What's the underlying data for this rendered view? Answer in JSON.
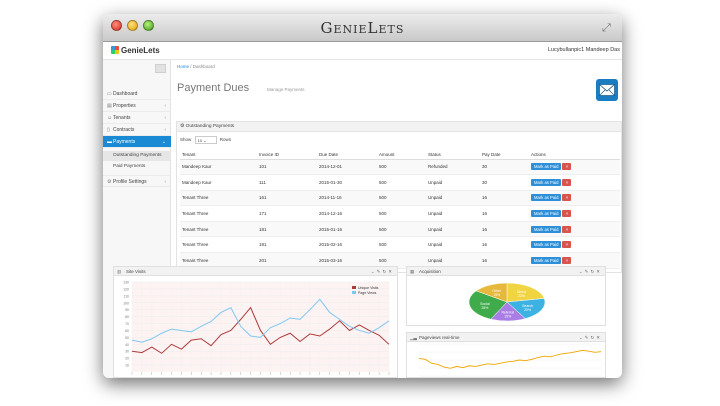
{
  "window": {
    "title": "GenieLets"
  },
  "topbar": {
    "brand": "GenieLets",
    "user": "Lucybullanpic1 Mandeep Das"
  },
  "sidebar": {
    "items": [
      {
        "label": "Dashboard",
        "icon": "monitor-icon"
      },
      {
        "label": "Properties",
        "icon": "building-icon"
      },
      {
        "label": "Tenants",
        "icon": "users-icon"
      },
      {
        "label": "Contracts",
        "icon": "document-icon"
      },
      {
        "label": "Payments",
        "icon": "card-icon"
      }
    ],
    "sub_items": [
      "Outstanding Payments",
      "Paid Payments"
    ],
    "profile": {
      "label": "Profile Settings",
      "icon": "gear-icon"
    }
  },
  "breadcrumb": {
    "home": "Home",
    "current": "Dashboard"
  },
  "page": {
    "title": "Payment Dues",
    "subtitle": "Manage Payments"
  },
  "panel": {
    "title": "Outstanding Payments",
    "show_label": "Show",
    "show_value": "10",
    "rows_label": "Rows"
  },
  "table": {
    "columns": [
      "Tenant",
      "Invoice ID",
      "Due Date",
      "Amount",
      "Status",
      "Pay Date",
      "Actions"
    ],
    "rows": [
      [
        "Mandeep Kaur",
        "101",
        "2014-12-01",
        "500",
        "Refunded",
        "30"
      ],
      [
        "Mandeep Kaur",
        "111",
        "2015-01-30",
        "500",
        "Unpaid",
        "30"
      ],
      [
        "Tenant Three",
        "161",
        "2014-11-16",
        "500",
        "Unpaid",
        "16"
      ],
      [
        "Tenant Three",
        "171",
        "2014-12-16",
        "500",
        "Unpaid",
        "16"
      ],
      [
        "Tenant Three",
        "181",
        "2015-01-16",
        "500",
        "Unpaid",
        "16"
      ],
      [
        "Tenant Three",
        "191",
        "2015-02-16",
        "500",
        "Unpaid",
        "16"
      ],
      [
        "Tenant Three",
        "201",
        "2015-03-16",
        "500",
        "Unpaid",
        "16"
      ]
    ],
    "action_label": "Mark as Paid",
    "delete_label": "×"
  },
  "widgets": {
    "site_visits": {
      "title": "Site Visits"
    },
    "acquisition": {
      "title": "Acquisition"
    },
    "pageviews": {
      "title": "Pageviews real-time"
    }
  },
  "chart_data": [
    {
      "type": "line",
      "title": "Site Visits",
      "ylim": [
        0,
        130
      ],
      "yticks": [
        "130",
        "120",
        "110",
        "100",
        "90",
        "80",
        "70",
        "60",
        "50",
        "40",
        "30",
        "20",
        "10"
      ],
      "x": [
        0,
        1,
        2,
        3,
        4,
        5,
        6,
        7,
        8,
        9,
        10,
        11,
        12,
        13,
        14,
        15,
        16,
        17,
        18,
        19,
        20,
        21,
        22,
        23,
        24,
        25,
        26
      ],
      "series": [
        {
          "name": "Unique Visits",
          "color": "#b03a3a",
          "values": [
            30,
            28,
            36,
            27,
            40,
            33,
            46,
            48,
            38,
            54,
            60,
            76,
            93,
            60,
            40,
            50,
            56,
            44,
            55,
            52,
            62,
            74,
            60,
            68,
            60,
            53,
            40
          ]
        },
        {
          "name": "Page Views",
          "color": "#7ec8f0",
          "values": [
            46,
            43,
            48,
            56,
            62,
            60,
            58,
            66,
            73,
            86,
            93,
            66,
            52,
            50,
            64,
            70,
            78,
            76,
            90,
            105,
            86,
            76,
            66,
            60,
            56,
            64,
            74
          ]
        }
      ],
      "legend": "top-right",
      "grid": true
    },
    {
      "type": "pie",
      "title": "Acquisition",
      "slices": [
        {
          "label": "Direct",
          "value": 22,
          "color": "#f1d442"
        },
        {
          "label": "Search",
          "value": 20,
          "color": "#3cb2e2"
        },
        {
          "label": "Referral",
          "value": 15,
          "color": "#a87ee6"
        },
        {
          "label": "Social",
          "value": 28,
          "color": "#3fab4b"
        },
        {
          "label": "Other",
          "value": 15,
          "color": "#e6b83c"
        }
      ]
    },
    {
      "type": "line",
      "title": "Pageviews real-time",
      "ylim": [
        0,
        100
      ],
      "series": [
        {
          "name": "",
          "color": "#f0a500",
          "values": [
            55,
            52,
            40,
            36,
            28,
            24,
            30,
            26,
            32,
            30,
            34,
            38,
            36,
            40,
            44,
            46,
            50,
            48,
            52,
            58,
            62,
            60,
            66,
            70,
            72,
            76,
            80,
            78,
            74,
            76
          ]
        }
      ]
    }
  ]
}
